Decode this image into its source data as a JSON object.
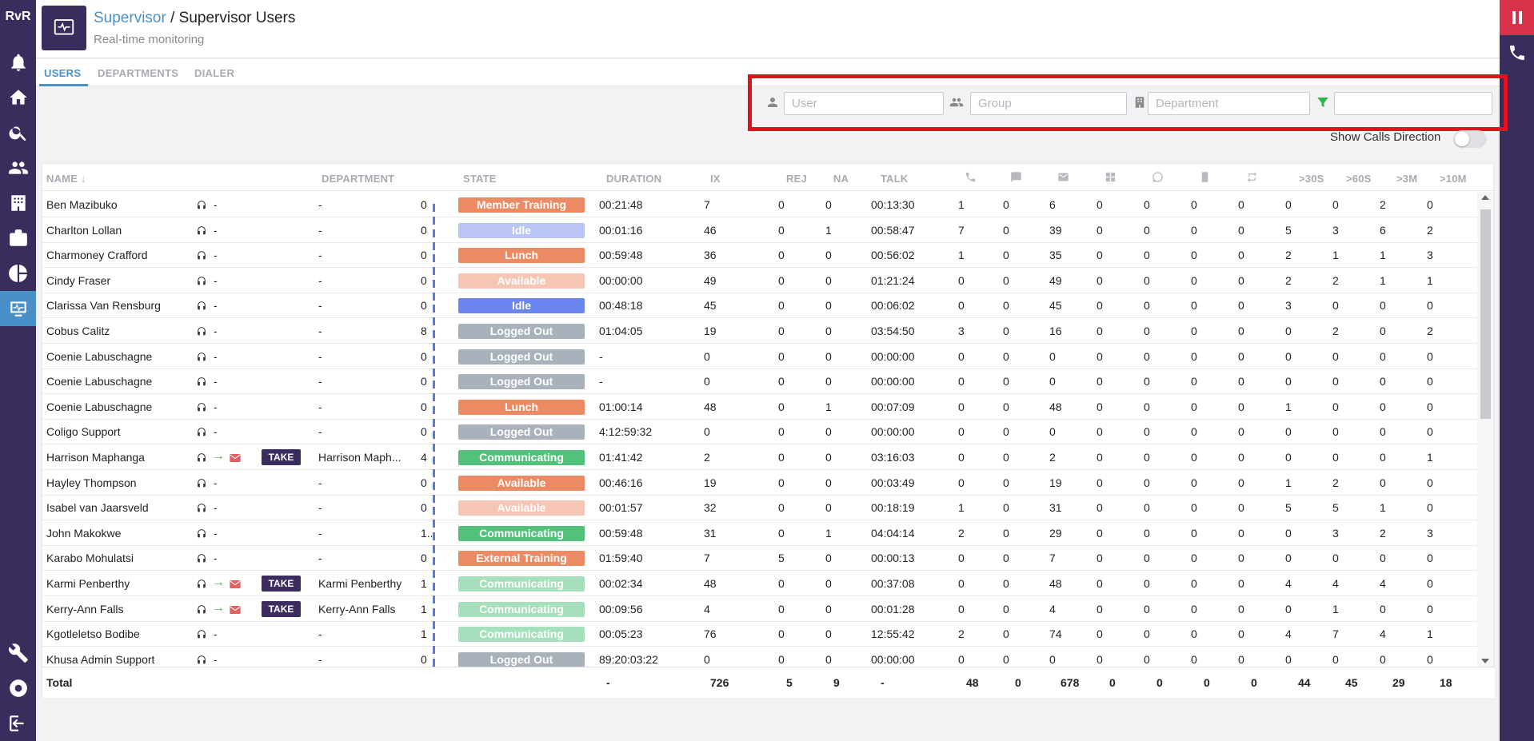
{
  "sidebar": {
    "logo": "RvR",
    "items": [
      {
        "name": "notifications"
      },
      {
        "name": "home"
      },
      {
        "name": "search"
      },
      {
        "name": "contacts"
      },
      {
        "name": "buildings"
      },
      {
        "name": "work"
      },
      {
        "name": "reports"
      },
      {
        "name": "supervisor",
        "active": true
      }
    ],
    "bottom": [
      {
        "name": "tools"
      },
      {
        "name": "support"
      },
      {
        "name": "logout"
      }
    ]
  },
  "header": {
    "breadcrumb_root": "Supervisor",
    "breadcrumb_sep": " / ",
    "breadcrumb_current": "Supervisor Users",
    "subtitle": "Real-time monitoring"
  },
  "tabs": [
    {
      "label": "USERS",
      "active": true
    },
    {
      "label": "DEPARTMENTS",
      "active": false
    },
    {
      "label": "DIALER",
      "active": false
    }
  ],
  "filters": {
    "user_placeholder": "User",
    "group_placeholder": "Group",
    "department_placeholder": "Department",
    "extra_value": ""
  },
  "show_calls_direction": {
    "label": "Show Calls Direction",
    "on": false
  },
  "table": {
    "columns": {
      "name": "NAME",
      "department": "DEPARTMENT",
      "state": "STATE",
      "duration": "DURATION",
      "ix": "IX",
      "rej": "REJ",
      "na": "NA",
      "talk": "TALK",
      "gt30s": ">30S",
      "gt60s": ">60S",
      "gt3m": ">3M",
      "gt10m": ">10M"
    },
    "state_colors": {
      "Member Training": "#ec8a63",
      "Idle": "#6b86ee",
      "Idle-light": "#b9c5f6",
      "Lunch": "#ec8a63",
      "Available": "#ec8a63",
      "Available-light": "#f5c6b4",
      "Logged Out": "#a9b1ba",
      "Communicating": "#52c17a",
      "Communicating-light": "#a6dfbb",
      "External Training": "#ec8a63"
    },
    "rows": [
      {
        "name": "Ben Mazibuko",
        "arrow": false,
        "take": false,
        "department": "-",
        "count": "0",
        "state": "Member Training",
        "style": "Member Training",
        "duration": "00:21:48",
        "ix": "7",
        "rej": "0",
        "na": "0",
        "talk": "00:13:30",
        "c1": "1",
        "c2": "0",
        "c3": "6",
        "c4": "0",
        "c5": "0",
        "c6": "0",
        "c7": "0",
        "s30": "0",
        "s60": "0",
        "m3": "2",
        "m10": "0"
      },
      {
        "name": "Charlton Lollan",
        "arrow": false,
        "take": false,
        "department": "-",
        "count": "0",
        "state": "Idle",
        "style": "Idle-light",
        "duration": "00:01:16",
        "ix": "46",
        "rej": "0",
        "na": "1",
        "talk": "00:58:47",
        "c1": "7",
        "c2": "0",
        "c3": "39",
        "c4": "0",
        "c5": "0",
        "c6": "0",
        "c7": "0",
        "s30": "5",
        "s60": "3",
        "m3": "6",
        "m10": "2"
      },
      {
        "name": "Charmoney Crafford",
        "arrow": false,
        "take": false,
        "department": "-",
        "count": "0",
        "state": "Lunch",
        "style": "Lunch",
        "duration": "00:59:48",
        "ix": "36",
        "rej": "0",
        "na": "0",
        "talk": "00:56:02",
        "c1": "1",
        "c2": "0",
        "c3": "35",
        "c4": "0",
        "c5": "0",
        "c6": "0",
        "c7": "0",
        "s30": "2",
        "s60": "1",
        "m3": "1",
        "m10": "3"
      },
      {
        "name": "Cindy Fraser",
        "arrow": false,
        "take": false,
        "department": "-",
        "count": "0",
        "state": "Available",
        "style": "Available-light",
        "duration": "00:00:00",
        "ix": "49",
        "rej": "0",
        "na": "0",
        "talk": "01:21:24",
        "c1": "0",
        "c2": "0",
        "c3": "49",
        "c4": "0",
        "c5": "0",
        "c6": "0",
        "c7": "0",
        "s30": "2",
        "s60": "2",
        "m3": "1",
        "m10": "1"
      },
      {
        "name": "Clarissa Van Rensburg",
        "arrow": false,
        "take": false,
        "department": "-",
        "count": "0",
        "state": "Idle",
        "style": "Idle",
        "duration": "00:48:18",
        "ix": "45",
        "rej": "0",
        "na": "0",
        "talk": "00:06:02",
        "c1": "0",
        "c2": "0",
        "c3": "45",
        "c4": "0",
        "c5": "0",
        "c6": "0",
        "c7": "0",
        "s30": "3",
        "s60": "0",
        "m3": "0",
        "m10": "0"
      },
      {
        "name": "Cobus Calitz",
        "arrow": false,
        "take": false,
        "department": "-",
        "count": "8",
        "state": "Logged Out",
        "style": "Logged Out",
        "duration": "01:04:05",
        "ix": "19",
        "rej": "0",
        "na": "0",
        "talk": "03:54:50",
        "c1": "3",
        "c2": "0",
        "c3": "16",
        "c4": "0",
        "c5": "0",
        "c6": "0",
        "c7": "0",
        "s30": "0",
        "s60": "2",
        "m3": "0",
        "m10": "2"
      },
      {
        "name": "Coenie Labuschagne",
        "arrow": false,
        "take": false,
        "department": "-",
        "count": "0",
        "state": "Logged Out",
        "style": "Logged Out",
        "duration": "-",
        "ix": "0",
        "rej": "0",
        "na": "0",
        "talk": "00:00:00",
        "c1": "0",
        "c2": "0",
        "c3": "0",
        "c4": "0",
        "c5": "0",
        "c6": "0",
        "c7": "0",
        "s30": "0",
        "s60": "0",
        "m3": "0",
        "m10": "0"
      },
      {
        "name": "Coenie Labuschagne",
        "arrow": false,
        "take": false,
        "department": "-",
        "count": "0",
        "state": "Logged Out",
        "style": "Logged Out",
        "duration": "-",
        "ix": "0",
        "rej": "0",
        "na": "0",
        "talk": "00:00:00",
        "c1": "0",
        "c2": "0",
        "c3": "0",
        "c4": "0",
        "c5": "0",
        "c6": "0",
        "c7": "0",
        "s30": "0",
        "s60": "0",
        "m3": "0",
        "m10": "0"
      },
      {
        "name": "Coenie Labuschagne",
        "arrow": false,
        "take": false,
        "department": "-",
        "count": "0",
        "state": "Lunch",
        "style": "Lunch",
        "duration": "01:00:14",
        "ix": "48",
        "rej": "0",
        "na": "1",
        "talk": "00:07:09",
        "c1": "0",
        "c2": "0",
        "c3": "48",
        "c4": "0",
        "c5": "0",
        "c6": "0",
        "c7": "0",
        "s30": "1",
        "s60": "0",
        "m3": "0",
        "m10": "0"
      },
      {
        "name": "Coligo Support",
        "arrow": false,
        "take": false,
        "department": "-",
        "count": "0",
        "state": "Logged Out",
        "style": "Logged Out",
        "duration": "4:12:59:32",
        "ix": "0",
        "rej": "0",
        "na": "0",
        "talk": "00:00:00",
        "c1": "0",
        "c2": "0",
        "c3": "0",
        "c4": "0",
        "c5": "0",
        "c6": "0",
        "c7": "0",
        "s30": "0",
        "s60": "0",
        "m3": "0",
        "m10": "0"
      },
      {
        "name": "Harrison Maphanga",
        "arrow": true,
        "take": true,
        "take_label": "TAKE",
        "department": "Harrison Maph...",
        "count": "4",
        "state": "Communicating",
        "style": "Communicating",
        "duration": "01:41:42",
        "ix": "2",
        "rej": "0",
        "na": "0",
        "talk": "03:16:03",
        "c1": "0",
        "c2": "0",
        "c3": "2",
        "c4": "0",
        "c5": "0",
        "c6": "0",
        "c7": "0",
        "s30": "0",
        "s60": "0",
        "m3": "0",
        "m10": "1"
      },
      {
        "name": "Hayley Thompson",
        "arrow": false,
        "take": false,
        "department": "-",
        "count": "0",
        "state": "Available",
        "style": "Available",
        "duration": "00:46:16",
        "ix": "19",
        "rej": "0",
        "na": "0",
        "talk": "00:03:49",
        "c1": "0",
        "c2": "0",
        "c3": "19",
        "c4": "0",
        "c5": "0",
        "c6": "0",
        "c7": "0",
        "s30": "1",
        "s60": "2",
        "m3": "0",
        "m10": "0"
      },
      {
        "name": "Isabel van Jaarsveld",
        "arrow": false,
        "take": false,
        "department": "-",
        "count": "0",
        "state": "Available",
        "style": "Available-light",
        "duration": "00:01:57",
        "ix": "32",
        "rej": "0",
        "na": "0",
        "talk": "00:18:19",
        "c1": "1",
        "c2": "0",
        "c3": "31",
        "c4": "0",
        "c5": "0",
        "c6": "0",
        "c7": "0",
        "s30": "5",
        "s60": "5",
        "m3": "1",
        "m10": "0"
      },
      {
        "name": "John Makokwe",
        "arrow": false,
        "take": false,
        "department": "-",
        "count": "1..",
        "state": "Communicating",
        "style": "Communicating",
        "duration": "00:59:48",
        "ix": "31",
        "rej": "0",
        "na": "1",
        "talk": "04:04:14",
        "c1": "2",
        "c2": "0",
        "c3": "29",
        "c4": "0",
        "c5": "0",
        "c6": "0",
        "c7": "0",
        "s30": "0",
        "s60": "3",
        "m3": "2",
        "m10": "3"
      },
      {
        "name": "Karabo Mohulatsi",
        "arrow": false,
        "take": false,
        "department": "-",
        "count": "0",
        "state": "External Training",
        "style": "External Training",
        "duration": "01:59:40",
        "ix": "7",
        "rej": "5",
        "na": "0",
        "talk": "00:00:13",
        "c1": "0",
        "c2": "0",
        "c3": "7",
        "c4": "0",
        "c5": "0",
        "c6": "0",
        "c7": "0",
        "s30": "0",
        "s60": "0",
        "m3": "0",
        "m10": "0"
      },
      {
        "name": "Karmi Penberthy",
        "arrow": true,
        "take": true,
        "take_label": "TAKE",
        "department": "Karmi Penberthy",
        "count": "1",
        "state": "Communicating",
        "style": "Communicating-light",
        "duration": "00:02:34",
        "ix": "48",
        "rej": "0",
        "na": "0",
        "talk": "00:37:08",
        "c1": "0",
        "c2": "0",
        "c3": "48",
        "c4": "0",
        "c5": "0",
        "c6": "0",
        "c7": "0",
        "s30": "4",
        "s60": "4",
        "m3": "4",
        "m10": "0"
      },
      {
        "name": "Kerry-Ann Falls",
        "arrow": true,
        "take": true,
        "take_label": "TAKE",
        "department": "Kerry-Ann Falls",
        "count": "1",
        "state": "Communicating",
        "style": "Communicating-light",
        "duration": "00:09:56",
        "ix": "4",
        "rej": "0",
        "na": "0",
        "talk": "00:01:28",
        "c1": "0",
        "c2": "0",
        "c3": "4",
        "c4": "0",
        "c5": "0",
        "c6": "0",
        "c7": "0",
        "s30": "0",
        "s60": "1",
        "m3": "0",
        "m10": "0"
      },
      {
        "name": "Kgotleletso Bodibe",
        "arrow": false,
        "take": false,
        "department": "-",
        "count": "1",
        "state": "Communicating",
        "style": "Communicating-light",
        "duration": "00:05:23",
        "ix": "76",
        "rej": "0",
        "na": "0",
        "talk": "12:55:42",
        "c1": "2",
        "c2": "0",
        "c3": "74",
        "c4": "0",
        "c5": "0",
        "c6": "0",
        "c7": "0",
        "s30": "4",
        "s60": "7",
        "m3": "4",
        "m10": "1"
      },
      {
        "name": "Khusa Admin Support",
        "arrow": false,
        "take": false,
        "department": "-",
        "count": "0",
        "state": "Logged Out",
        "style": "Logged Out",
        "duration": "89:20:03:22",
        "ix": "0",
        "rej": "0",
        "na": "0",
        "talk": "00:00:00",
        "c1": "0",
        "c2": "0",
        "c3": "0",
        "c4": "0",
        "c5": "0",
        "c6": "0",
        "c7": "0",
        "s30": "0",
        "s60": "0",
        "m3": "0",
        "m10": "0"
      }
    ],
    "total": {
      "label": "Total",
      "duration": "-",
      "ix": "726",
      "rej": "5",
      "na": "9",
      "talk": "-",
      "c1": "48",
      "c2": "0",
      "c3": "678",
      "c4": "0",
      "c5": "0",
      "c6": "0",
      "c7": "0",
      "s30": "44",
      "s60": "45",
      "m3": "29",
      "m10": "18"
    }
  }
}
